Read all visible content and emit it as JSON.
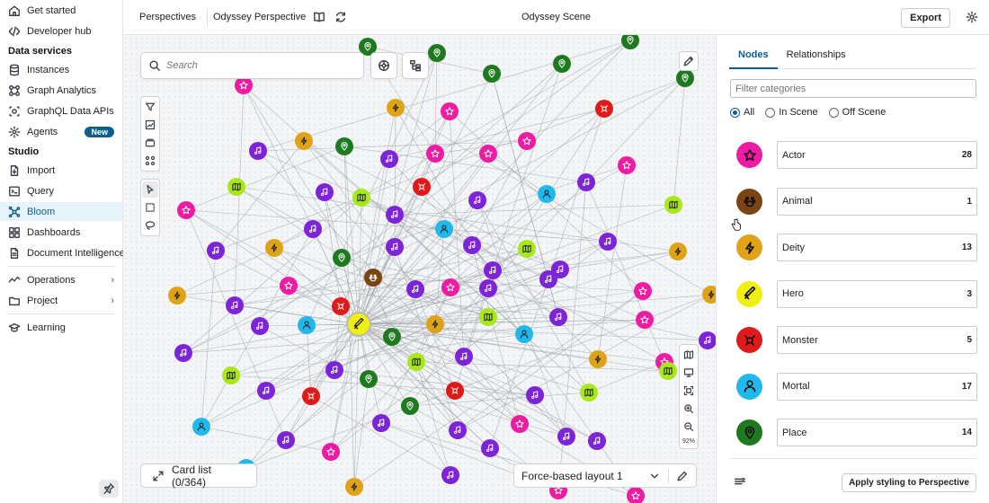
{
  "sidebar": {
    "items_top": [
      {
        "label": "Get started",
        "icon": "home-icon"
      },
      {
        "label": "Developer hub",
        "icon": "code-icon"
      }
    ],
    "section_data_services": "Data services",
    "items_data": [
      {
        "label": "Instances",
        "icon": "database-icon"
      },
      {
        "label": "Graph Analytics",
        "icon": "graph-analytics-icon"
      },
      {
        "label": "GraphQL Data APIs",
        "icon": "graphql-icon"
      },
      {
        "label": "Agents",
        "icon": "agents-icon",
        "badge": "New"
      }
    ],
    "section_studio": "Studio",
    "items_studio": [
      {
        "label": "Import",
        "icon": "import-icon"
      },
      {
        "label": "Query",
        "icon": "query-icon"
      },
      {
        "label": "Bloom",
        "icon": "bloom-icon",
        "active": true
      },
      {
        "label": "Dashboards",
        "icon": "dashboards-icon"
      },
      {
        "label": "Document Intelligence",
        "icon": "document-icon"
      }
    ],
    "items_bottom": [
      {
        "label": "Operations",
        "icon": "operations-icon",
        "chevron": true
      },
      {
        "label": "Project",
        "icon": "folder-icon",
        "chevron": true
      },
      {
        "label": "Learning",
        "icon": "learning-icon"
      }
    ]
  },
  "topbar": {
    "perspectives_label": "Perspectives",
    "perspective_name": "Odyssey Perspective",
    "scene_title": "Odyssey Scene",
    "export_label": "Export"
  },
  "canvas": {
    "search_placeholder": "Search",
    "zoom_label": "92%",
    "card_list_label": "Card list (0/364)",
    "layout_label": "Force-based layout 1"
  },
  "categories_colors": {
    "Actor": "#ee1ba3",
    "Animal": "#7a4512",
    "Deity": "#e0a318",
    "Hero": "#f0ef12",
    "Monster": "#e01a1a",
    "Mortal": "#21b8ec",
    "Place": "#1f7a1f",
    "Song": "#7d23d8",
    "Item": "#a6e81a"
  },
  "panel": {
    "tab_nodes": "Nodes",
    "tab_relationships": "Relationships",
    "filter_placeholder": "Filter categories",
    "radio_all": "All",
    "radio_in_scene": "In Scene",
    "radio_off_scene": "Off Scene",
    "categories": [
      {
        "name": "Actor",
        "count": "28",
        "color": "#ee1ba3",
        "icon": "star-icon"
      },
      {
        "name": "Animal",
        "count": "1",
        "color": "#7a4512",
        "icon": "paw-icon"
      },
      {
        "name": "Deity",
        "count": "13",
        "color": "#e0a318",
        "icon": "lightning-icon"
      },
      {
        "name": "Hero",
        "count": "3",
        "color": "#f0ef12",
        "icon": "sword-icon"
      },
      {
        "name": "Monster",
        "count": "5",
        "color": "#e01a1a",
        "icon": "monster-icon"
      },
      {
        "name": "Mortal",
        "count": "17",
        "color": "#21b8ec",
        "icon": "person-icon"
      },
      {
        "name": "Place",
        "count": "14",
        "color": "#1f7a1f",
        "icon": "pin-icon"
      }
    ],
    "apply_label": "Apply styling to Perspective"
  }
}
